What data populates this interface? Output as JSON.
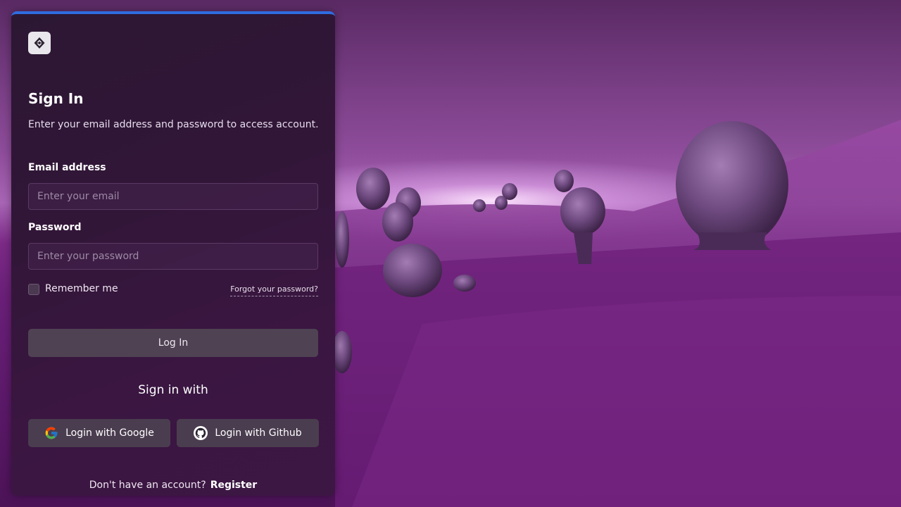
{
  "app": {
    "logo_icon": "cube-logo-icon",
    "accent_color": "#2e6cdf"
  },
  "form": {
    "title": "Sign In",
    "subtitle": "Enter your email address and password to access account.",
    "email_label": "Email address",
    "email_placeholder": "Enter your email",
    "email_value": "",
    "password_label": "Password",
    "password_placeholder": "Enter your password",
    "password_value": "",
    "remember_label": "Remember me",
    "remember_checked": false,
    "forgot_link": "Forgot your password?",
    "login_button": "Log In"
  },
  "social": {
    "heading": "Sign in with",
    "google_label": "Login with Google",
    "google_icon": "google-icon",
    "github_label": "Login with Github",
    "github_icon": "github-icon"
  },
  "footer": {
    "prompt": "Don't have an account?",
    "register_link": "Register"
  }
}
